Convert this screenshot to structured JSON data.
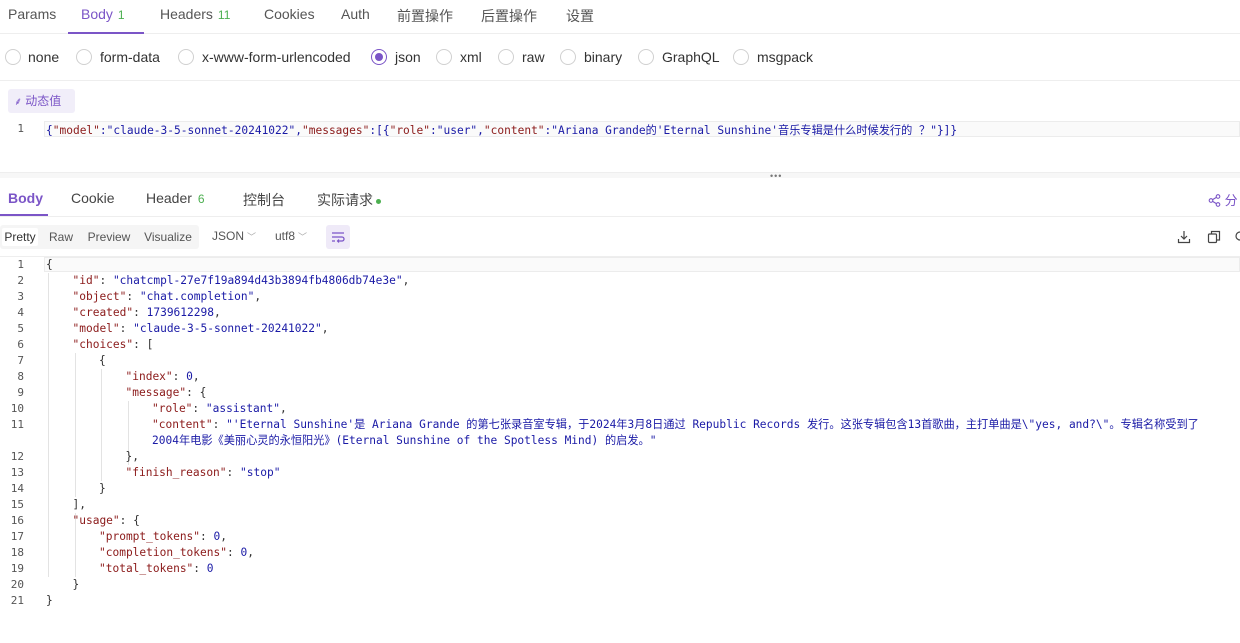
{
  "request_tabs": [
    {
      "label": "Params",
      "count": ""
    },
    {
      "label": "Body",
      "count": "1"
    },
    {
      "label": "Headers",
      "count": "11"
    },
    {
      "label": "Cookies",
      "count": ""
    },
    {
      "label": "Auth",
      "count": ""
    },
    {
      "label": "前置操作",
      "count": ""
    },
    {
      "label": "后置操作",
      "count": ""
    },
    {
      "label": "设置",
      "count": ""
    }
  ],
  "active_request_tab": "Body",
  "body_types": [
    "none",
    "form-data",
    "x-www-form-urlencoded",
    "json",
    "xml",
    "raw",
    "binary",
    "GraphQL",
    "msgpack"
  ],
  "selected_body_type": "json",
  "dynamic_value_button": "动态值",
  "request_body": {
    "line_number": "1",
    "parts": [
      [
        "{",
        "p"
      ],
      [
        "\"model\"",
        "k"
      ],
      [
        ":",
        "p"
      ],
      [
        "\"claude-3-5-sonnet-20241022\"",
        "s"
      ],
      [
        ",",
        "p"
      ],
      [
        "\"messages\"",
        "k"
      ],
      [
        ":[{",
        "p"
      ],
      [
        "\"role\"",
        "k"
      ],
      [
        ":",
        "p"
      ],
      [
        "\"user\"",
        "s"
      ],
      [
        ",",
        "p"
      ],
      [
        "\"content\"",
        "k"
      ],
      [
        ":",
        "p"
      ],
      [
        "\"Ariana Grande的'Eternal Sunshine'音乐专辑是什么时候发行的 ？\"",
        "s"
      ],
      [
        "}]}",
        "p"
      ]
    ]
  },
  "response_tabs": [
    {
      "label": "Body",
      "count": ""
    },
    {
      "label": "Cookie",
      "count": ""
    },
    {
      "label": "Header",
      "count": "6"
    },
    {
      "label": "控制台",
      "count": ""
    },
    {
      "label": "实际请求",
      "count": ""
    }
  ],
  "active_response_tab": "Body",
  "share_label": "分",
  "view_modes": [
    "Pretty",
    "Raw",
    "Preview",
    "Visualize"
  ],
  "active_view_mode": "Pretty",
  "format_select": "JSON",
  "encoding_select": "utf8",
  "response_lines": [
    {
      "n": "1",
      "indent": 0,
      "parts": [
        [
          "{",
          "p"
        ]
      ]
    },
    {
      "n": "2",
      "indent": 1,
      "parts": [
        [
          "\"id\"",
          "k"
        ],
        [
          ": ",
          "p"
        ],
        [
          "\"chatcmpl-27e7f19a894d43b3894fb4806db74e3e\"",
          "s"
        ],
        [
          ",",
          "p"
        ]
      ]
    },
    {
      "n": "3",
      "indent": 1,
      "parts": [
        [
          "\"object\"",
          "k"
        ],
        [
          ": ",
          "p"
        ],
        [
          "\"chat.completion\"",
          "s"
        ],
        [
          ",",
          "p"
        ]
      ]
    },
    {
      "n": "4",
      "indent": 1,
      "parts": [
        [
          "\"created\"",
          "k"
        ],
        [
          ": ",
          "p"
        ],
        [
          "1739612298",
          "n"
        ],
        [
          ",",
          "p"
        ]
      ]
    },
    {
      "n": "5",
      "indent": 1,
      "parts": [
        [
          "\"model\"",
          "k"
        ],
        [
          ": ",
          "p"
        ],
        [
          "\"claude-3-5-sonnet-20241022\"",
          "s"
        ],
        [
          ",",
          "p"
        ]
      ]
    },
    {
      "n": "6",
      "indent": 1,
      "parts": [
        [
          "\"choices\"",
          "k"
        ],
        [
          ": [",
          "p"
        ]
      ]
    },
    {
      "n": "7",
      "indent": 2,
      "parts": [
        [
          "{",
          "p"
        ]
      ]
    },
    {
      "n": "8",
      "indent": 3,
      "parts": [
        [
          "\"index\"",
          "k"
        ],
        [
          ": ",
          "p"
        ],
        [
          "0",
          "n"
        ],
        [
          ",",
          "p"
        ]
      ]
    },
    {
      "n": "9",
      "indent": 3,
      "parts": [
        [
          "\"message\"",
          "k"
        ],
        [
          ": {",
          "p"
        ]
      ]
    },
    {
      "n": "10",
      "indent": 4,
      "parts": [
        [
          "\"role\"",
          "k"
        ],
        [
          ": ",
          "p"
        ],
        [
          "\"assistant\"",
          "s"
        ],
        [
          ",",
          "p"
        ]
      ]
    },
    {
      "n": "11",
      "indent": 4,
      "parts": [
        [
          "\"content\"",
          "k"
        ],
        [
          ": ",
          "p"
        ],
        [
          "\"'Eternal Sunshine'是 Ariana Grande 的第七张录音室专辑，于2024年3月8日通过 Republic Records 发行。这张专辑包含13首歌曲，主打单曲是\\\"yes, and?\\\"。专辑名称受到了",
          "s"
        ]
      ]
    },
    {
      "n": "",
      "indent": 4,
      "parts": [
        [
          "2004年电影《美丽心灵的永恒阳光》(Eternal Sunshine of the Spotless Mind) 的启发。\"",
          "s"
        ]
      ]
    },
    {
      "n": "12",
      "indent": 3,
      "parts": [
        [
          "},",
          "p"
        ]
      ]
    },
    {
      "n": "13",
      "indent": 3,
      "parts": [
        [
          "\"finish_reason\"",
          "k"
        ],
        [
          ": ",
          "p"
        ],
        [
          "\"stop\"",
          "s"
        ]
      ]
    },
    {
      "n": "14",
      "indent": 2,
      "parts": [
        [
          "}",
          "p"
        ]
      ]
    },
    {
      "n": "15",
      "indent": 1,
      "parts": [
        [
          "],",
          "p"
        ]
      ]
    },
    {
      "n": "16",
      "indent": 1,
      "parts": [
        [
          "\"usage\"",
          "k"
        ],
        [
          ": {",
          "p"
        ]
      ]
    },
    {
      "n": "17",
      "indent": 2,
      "parts": [
        [
          "\"prompt_tokens\"",
          "k"
        ],
        [
          ": ",
          "p"
        ],
        [
          "0",
          "n"
        ],
        [
          ",",
          "p"
        ]
      ]
    },
    {
      "n": "18",
      "indent": 2,
      "parts": [
        [
          "\"completion_tokens\"",
          "k"
        ],
        [
          ": ",
          "p"
        ],
        [
          "0",
          "n"
        ],
        [
          ",",
          "p"
        ]
      ]
    },
    {
      "n": "19",
      "indent": 2,
      "parts": [
        [
          "\"total_tokens\"",
          "k"
        ],
        [
          ": ",
          "p"
        ],
        [
          "0",
          "n"
        ]
      ]
    },
    {
      "n": "20",
      "indent": 1,
      "parts": [
        [
          "}",
          "p"
        ]
      ]
    },
    {
      "n": "21",
      "indent": 0,
      "parts": [
        [
          "}",
          "p"
        ]
      ]
    }
  ]
}
